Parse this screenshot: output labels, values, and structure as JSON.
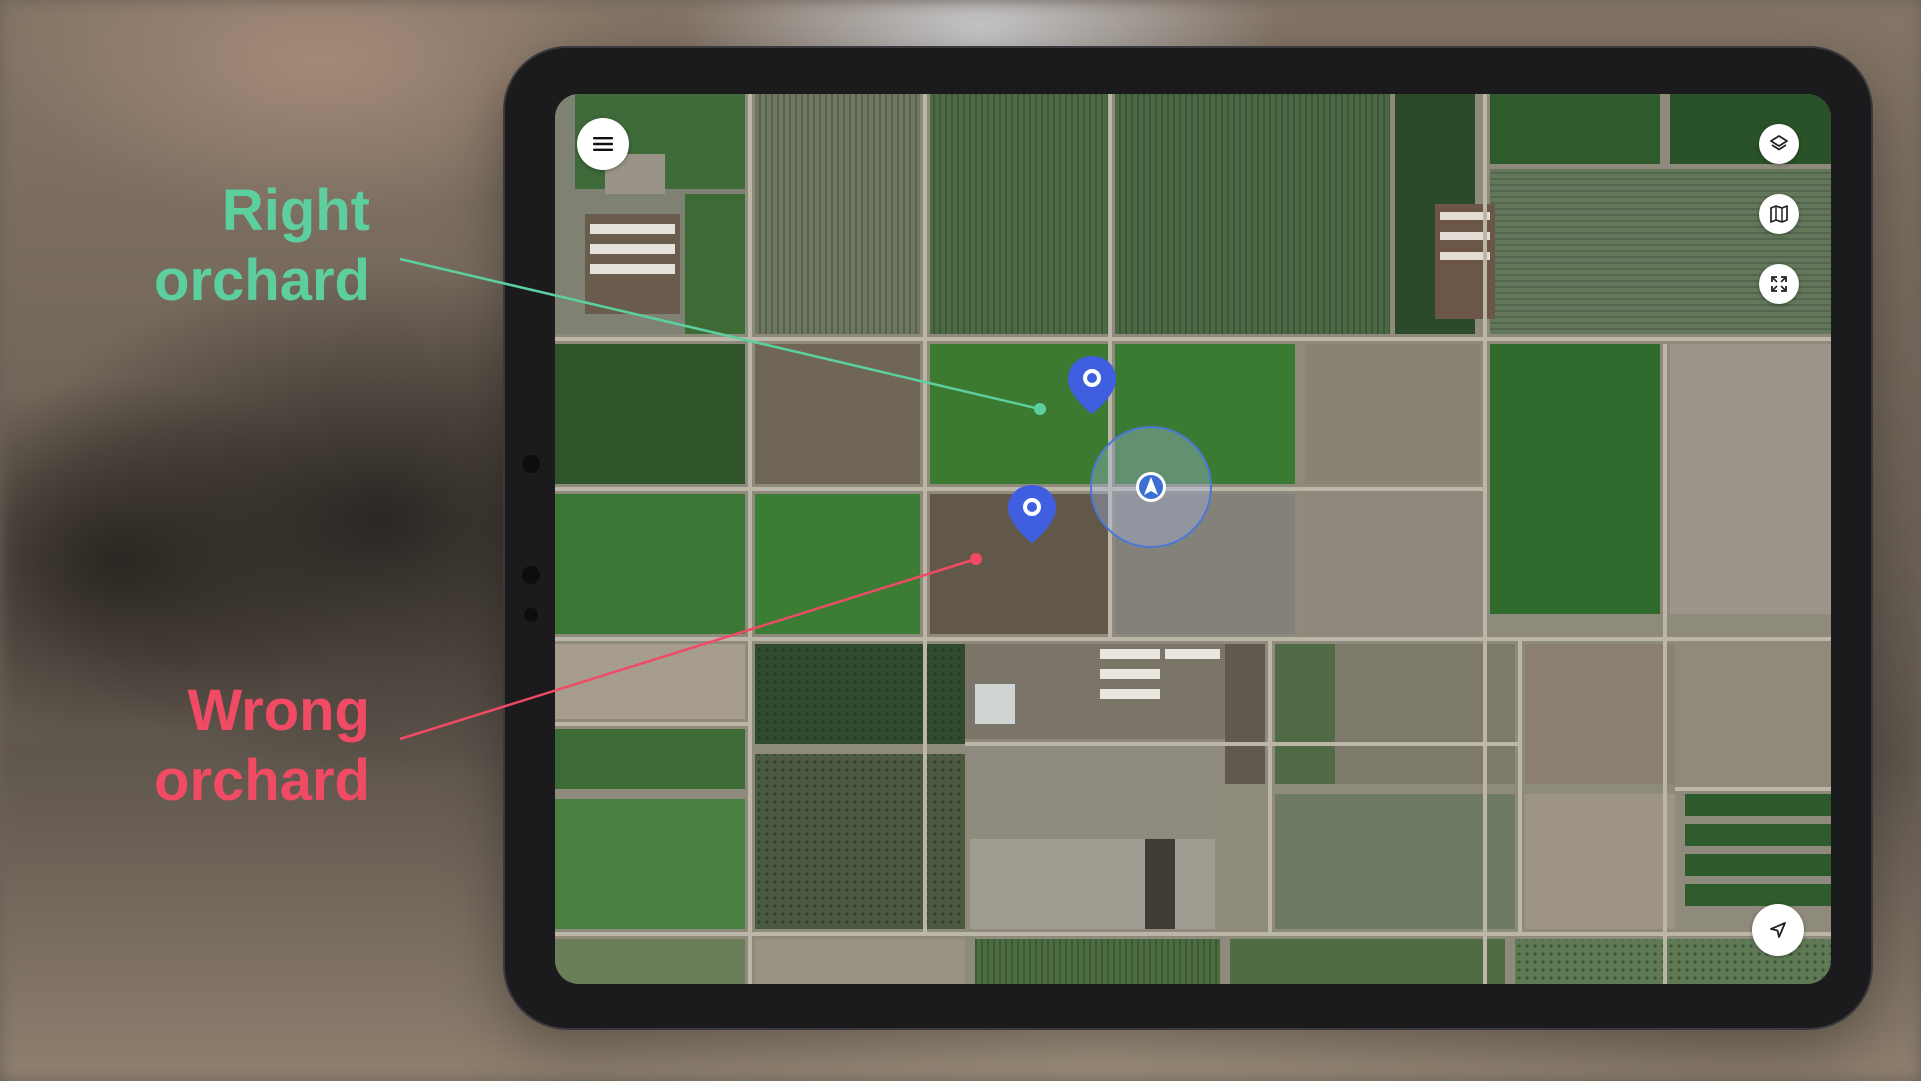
{
  "annotations": {
    "right": {
      "line1": "Right",
      "line2": "orchard",
      "color": "#5dcf9f"
    },
    "wrong": {
      "line1": "Wrong",
      "line2": "orchard",
      "color": "#f04a64"
    }
  },
  "map": {
    "style": "satellite",
    "pin_color": "#3f5fe0",
    "location_accent": "#3b6fd1",
    "controls": [
      "menu-icon",
      "layers-icon",
      "map-icon",
      "fullscreen-icon",
      "navigate-icon"
    ]
  }
}
